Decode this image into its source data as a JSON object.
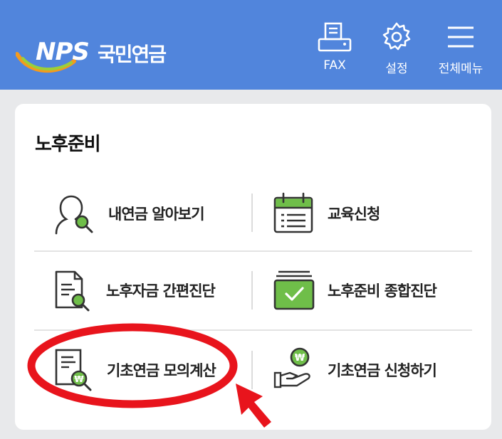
{
  "header": {
    "logo_en": "NPS",
    "logo_kr": "국민연금",
    "fax_label": "FAX",
    "settings_label": "설정",
    "menu_label": "전체메뉴",
    "background": "#5185dc"
  },
  "card": {
    "title": "노후준비",
    "items": [
      {
        "label": "내연금 알아보기",
        "icon": "person-search-icon"
      },
      {
        "label": "교육신청",
        "icon": "calendar-icon"
      },
      {
        "label": "노후자금 간편진단",
        "icon": "document-search-icon"
      },
      {
        "label": "노후준비 종합진단",
        "icon": "checklist-stack-icon"
      },
      {
        "label": "기초연금 모의계산",
        "icon": "won-document-icon"
      },
      {
        "label": "기초연금 신청하기",
        "icon": "won-hand-icon"
      }
    ]
  },
  "colors": {
    "accent_green": "#6fbe49",
    "highlight_red": "#e8141c"
  }
}
